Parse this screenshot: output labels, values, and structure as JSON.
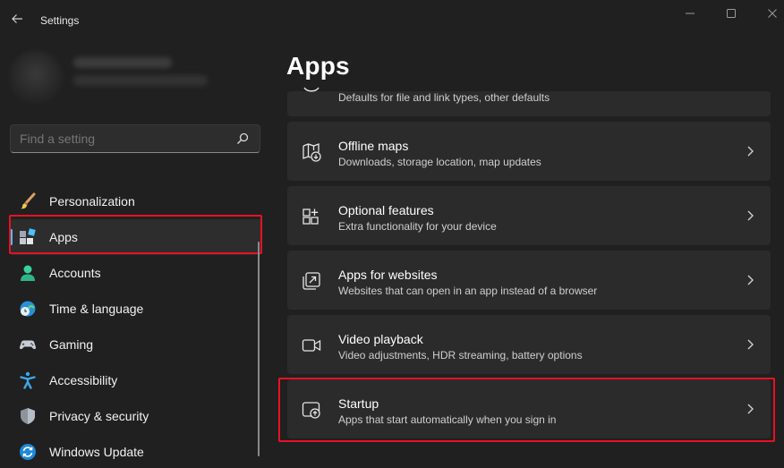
{
  "titlebar": {
    "title": "Settings"
  },
  "search": {
    "placeholder": "Find a setting"
  },
  "sidebar": {
    "items": [
      {
        "label": "Personalization",
        "icon": "paintbrush-icon"
      },
      {
        "label": "Apps",
        "icon": "apps-icon",
        "selected": true
      },
      {
        "label": "Accounts",
        "icon": "accounts-icon"
      },
      {
        "label": "Time & language",
        "icon": "clock-globe-icon"
      },
      {
        "label": "Gaming",
        "icon": "gamepad-icon"
      },
      {
        "label": "Accessibility",
        "icon": "accessibility-icon"
      },
      {
        "label": "Privacy & security",
        "icon": "shield-icon"
      },
      {
        "label": "Windows Update",
        "icon": "update-icon"
      }
    ]
  },
  "main": {
    "title": "Apps",
    "cards": [
      {
        "title": "",
        "desc": "Defaults for file and link types, other defaults"
      },
      {
        "title": "Offline maps",
        "desc": "Downloads, storage location, map updates"
      },
      {
        "title": "Optional features",
        "desc": "Extra functionality for your device"
      },
      {
        "title": "Apps for websites",
        "desc": "Websites that can open in an app instead of a browser"
      },
      {
        "title": "Video playback",
        "desc": "Video adjustments, HDR streaming, battery options"
      },
      {
        "title": "Startup",
        "desc": "Apps that start automatically when you sign in"
      }
    ]
  },
  "colors": {
    "accent": "#4cc2ff",
    "highlight": "#e81123",
    "background": "#202020",
    "card": "#2b2b2b"
  }
}
